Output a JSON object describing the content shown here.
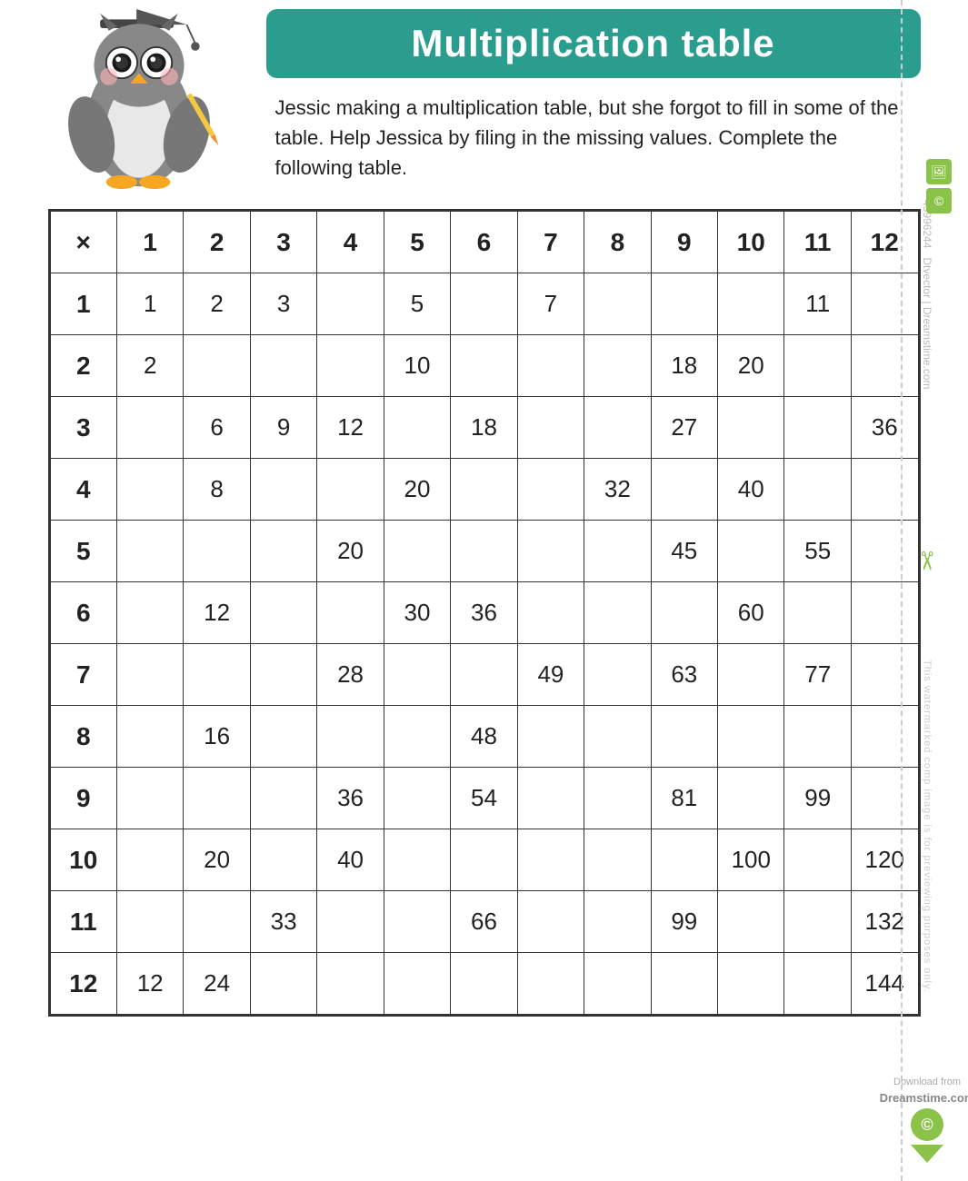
{
  "title": "Multiplication table",
  "description": "Jessic making a multiplication table, but she forgot to fill in some of the table. Help Jessica by filing in the missing values. Complete the following table.",
  "table": {
    "header_row": [
      "×",
      "1",
      "2",
      "3",
      "4",
      "5",
      "6",
      "7",
      "8",
      "9",
      "10",
      "11",
      "12"
    ],
    "rows": [
      {
        "label": "1",
        "cells": [
          "1",
          "2",
          "3",
          "",
          "5",
          "",
          "7",
          "",
          "",
          "",
          "11",
          ""
        ]
      },
      {
        "label": "2",
        "cells": [
          "2",
          "",
          "",
          "",
          "10",
          "",
          "",
          "",
          "18",
          "20",
          "",
          ""
        ]
      },
      {
        "label": "3",
        "cells": [
          "",
          "6",
          "9",
          "12",
          "",
          "18",
          "",
          "",
          "27",
          "",
          "",
          "36"
        ]
      },
      {
        "label": "4",
        "cells": [
          "",
          "8",
          "",
          "",
          "20",
          "",
          "",
          "32",
          "",
          "40",
          "",
          ""
        ]
      },
      {
        "label": "5",
        "cells": [
          "",
          "",
          "",
          "20",
          "",
          "",
          "",
          "",
          "45",
          "",
          "55",
          ""
        ]
      },
      {
        "label": "6",
        "cells": [
          "",
          "12",
          "",
          "",
          "30",
          "36",
          "",
          "",
          "",
          "60",
          "",
          ""
        ]
      },
      {
        "label": "7",
        "cells": [
          "",
          "",
          "",
          "28",
          "",
          "",
          "49",
          "",
          "63",
          "",
          "77",
          ""
        ]
      },
      {
        "label": "8",
        "cells": [
          "",
          "16",
          "",
          "",
          "",
          "48",
          "",
          "",
          "",
          "",
          "",
          ""
        ]
      },
      {
        "label": "9",
        "cells": [
          "",
          "",
          "",
          "36",
          "",
          "54",
          "",
          "",
          "81",
          "",
          "99",
          ""
        ]
      },
      {
        "label": "10",
        "cells": [
          "",
          "20",
          "",
          "40",
          "",
          "",
          "",
          "",
          "",
          "100",
          "",
          "120"
        ]
      },
      {
        "label": "11",
        "cells": [
          "",
          "",
          "33",
          "",
          "",
          "66",
          "",
          "",
          "99",
          "",
          "",
          "132"
        ]
      },
      {
        "label": "12",
        "cells": [
          "12",
          "24",
          "",
          "",
          "",
          "",
          "",
          "",
          "",
          "",
          "",
          "144"
        ]
      }
    ]
  }
}
